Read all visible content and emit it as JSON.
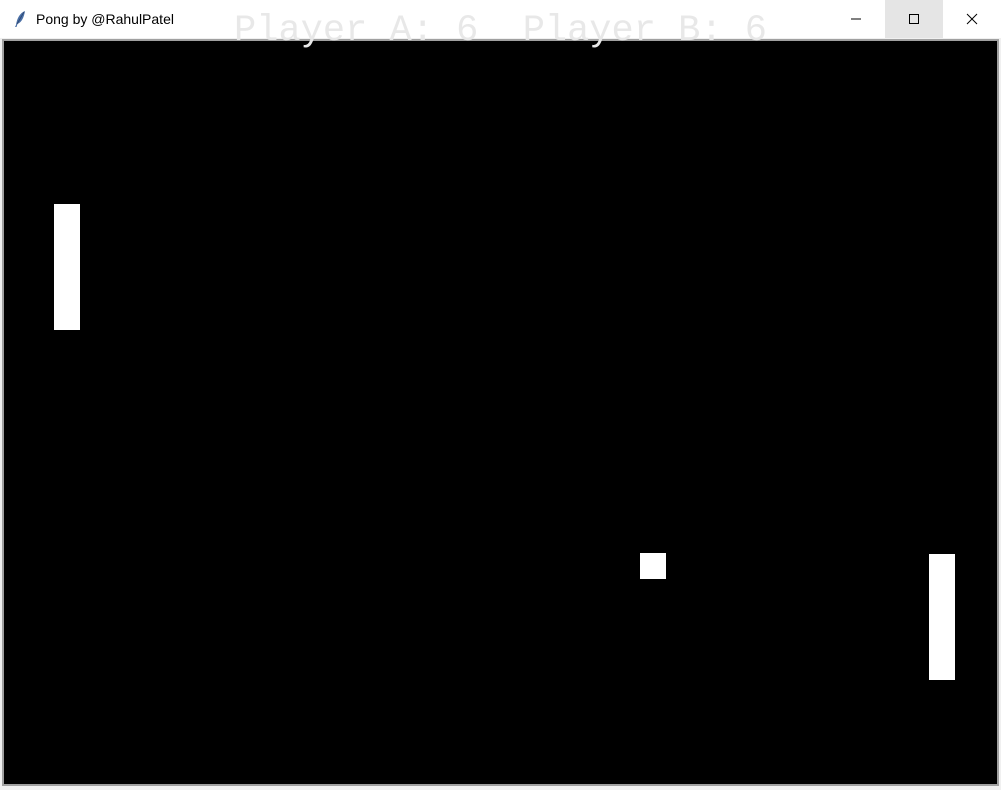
{
  "window": {
    "title": "Pong by @RahulPatel",
    "icon": "tk-feather-icon",
    "controls": {
      "minimize_icon": "minimize-icon",
      "maximize_icon": "maximize-icon",
      "close_icon": "close-icon"
    }
  },
  "game": {
    "background_color": "#000000",
    "foreground_color": "#ffffff",
    "scoreboard": {
      "text": "Player A: 6  Player B: 6",
      "player_a_label": "Player A",
      "player_a_score": 6,
      "player_b_label": "Player B",
      "player_b_score": 6
    }
  }
}
